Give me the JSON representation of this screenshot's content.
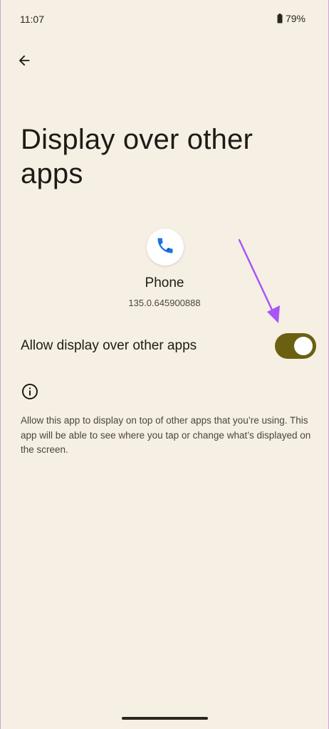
{
  "status_bar": {
    "time": "11:07",
    "battery_percent": "79%",
    "icons": [
      "battery-icon"
    ]
  },
  "header": {
    "back_icon": "arrow-left-icon",
    "title": "Display over other apps"
  },
  "app": {
    "icon": "phone-icon",
    "name": "Phone",
    "version": "135.0.645900888"
  },
  "setting": {
    "label": "Allow display over other apps",
    "enabled": true,
    "accent_color": "#6b5f12"
  },
  "info": {
    "icon": "info-icon",
    "text": "Allow this app to display on top of other apps that you’re using. This app will be able to see where you tap or change what’s displayed on the screen."
  },
  "annotation": {
    "icon": "arrow-annotation-icon",
    "color": "#a855f7"
  }
}
